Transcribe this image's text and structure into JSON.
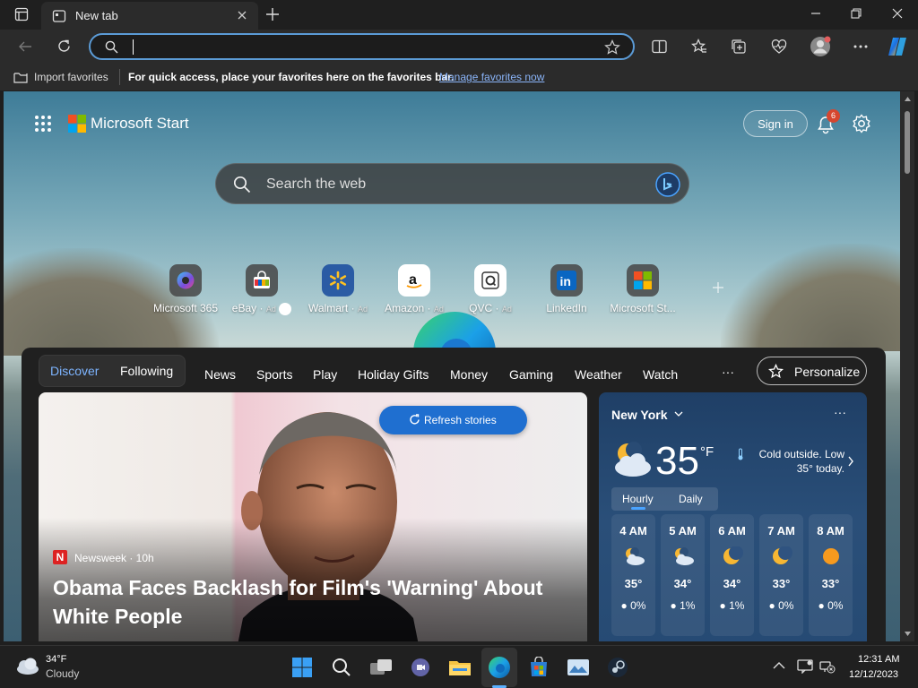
{
  "browser": {
    "tab_title": "New tab",
    "address_value": "",
    "favorites_bar": {
      "import_label": "Import favorites",
      "hint": "For quick access, place your favorites here on the favorites bar.",
      "manage_link": "Manage favorites now"
    },
    "profile_badge_color": "#e35e5e"
  },
  "start": {
    "brand": "Microsoft Start",
    "sign_in": "Sign in",
    "notif_count": "6",
    "search_placeholder": "Search the web",
    "quick_links": [
      {
        "label": "Microsoft 365",
        "ad": ""
      },
      {
        "label": "eBay",
        "ad": "Ad"
      },
      {
        "label": "Walmart",
        "ad": "Ad"
      },
      {
        "label": "Amazon",
        "ad": "Ad"
      },
      {
        "label": "QVC",
        "ad": "Ad"
      },
      {
        "label": "LinkedIn",
        "ad": ""
      },
      {
        "label": "Microsoft St...",
        "ad": ""
      }
    ],
    "feed_tabs": [
      "Discover",
      "Following"
    ],
    "nav_items": [
      "News",
      "Sports",
      "Play",
      "Holiday Gifts",
      "Money",
      "Gaming",
      "Weather",
      "Watch"
    ],
    "more": "···",
    "personalize": "Personalize",
    "refresh": "Refresh stories",
    "hero": {
      "source_icon": "N",
      "source": "Newsweek · 10h",
      "title": "Obama Faces Backlash for Film's 'Warning' About White People"
    },
    "weather": {
      "location": "New York",
      "temp": "35",
      "unit": "°F",
      "summary": "Cold outside. Low 35° today.",
      "tabs": [
        "Hourly",
        "Daily"
      ],
      "hours": [
        {
          "time": "4 AM",
          "temp": "35°",
          "precip": "0%",
          "icon": "partly-cloudy-night-icon"
        },
        {
          "time": "5 AM",
          "temp": "34°",
          "precip": "1%",
          "icon": "partly-cloudy-night-icon"
        },
        {
          "time": "6 AM",
          "temp": "34°",
          "precip": "1%",
          "icon": "moon-icon"
        },
        {
          "time": "7 AM",
          "temp": "33°",
          "precip": "0%",
          "icon": "moon-icon"
        },
        {
          "time": "8 AM",
          "temp": "33°",
          "precip": "0%",
          "icon": "sun-icon"
        }
      ]
    }
  },
  "taskbar": {
    "weather_temp": "34°F",
    "weather_desc": "Cloudy",
    "time": "12:31 AM",
    "date": "12/12/2023"
  },
  "colors": {
    "accent": "#5b9bd6",
    "discover": "#7db4ff",
    "refresh_button": "#1f6fd0",
    "link": "#8ab4f8"
  }
}
